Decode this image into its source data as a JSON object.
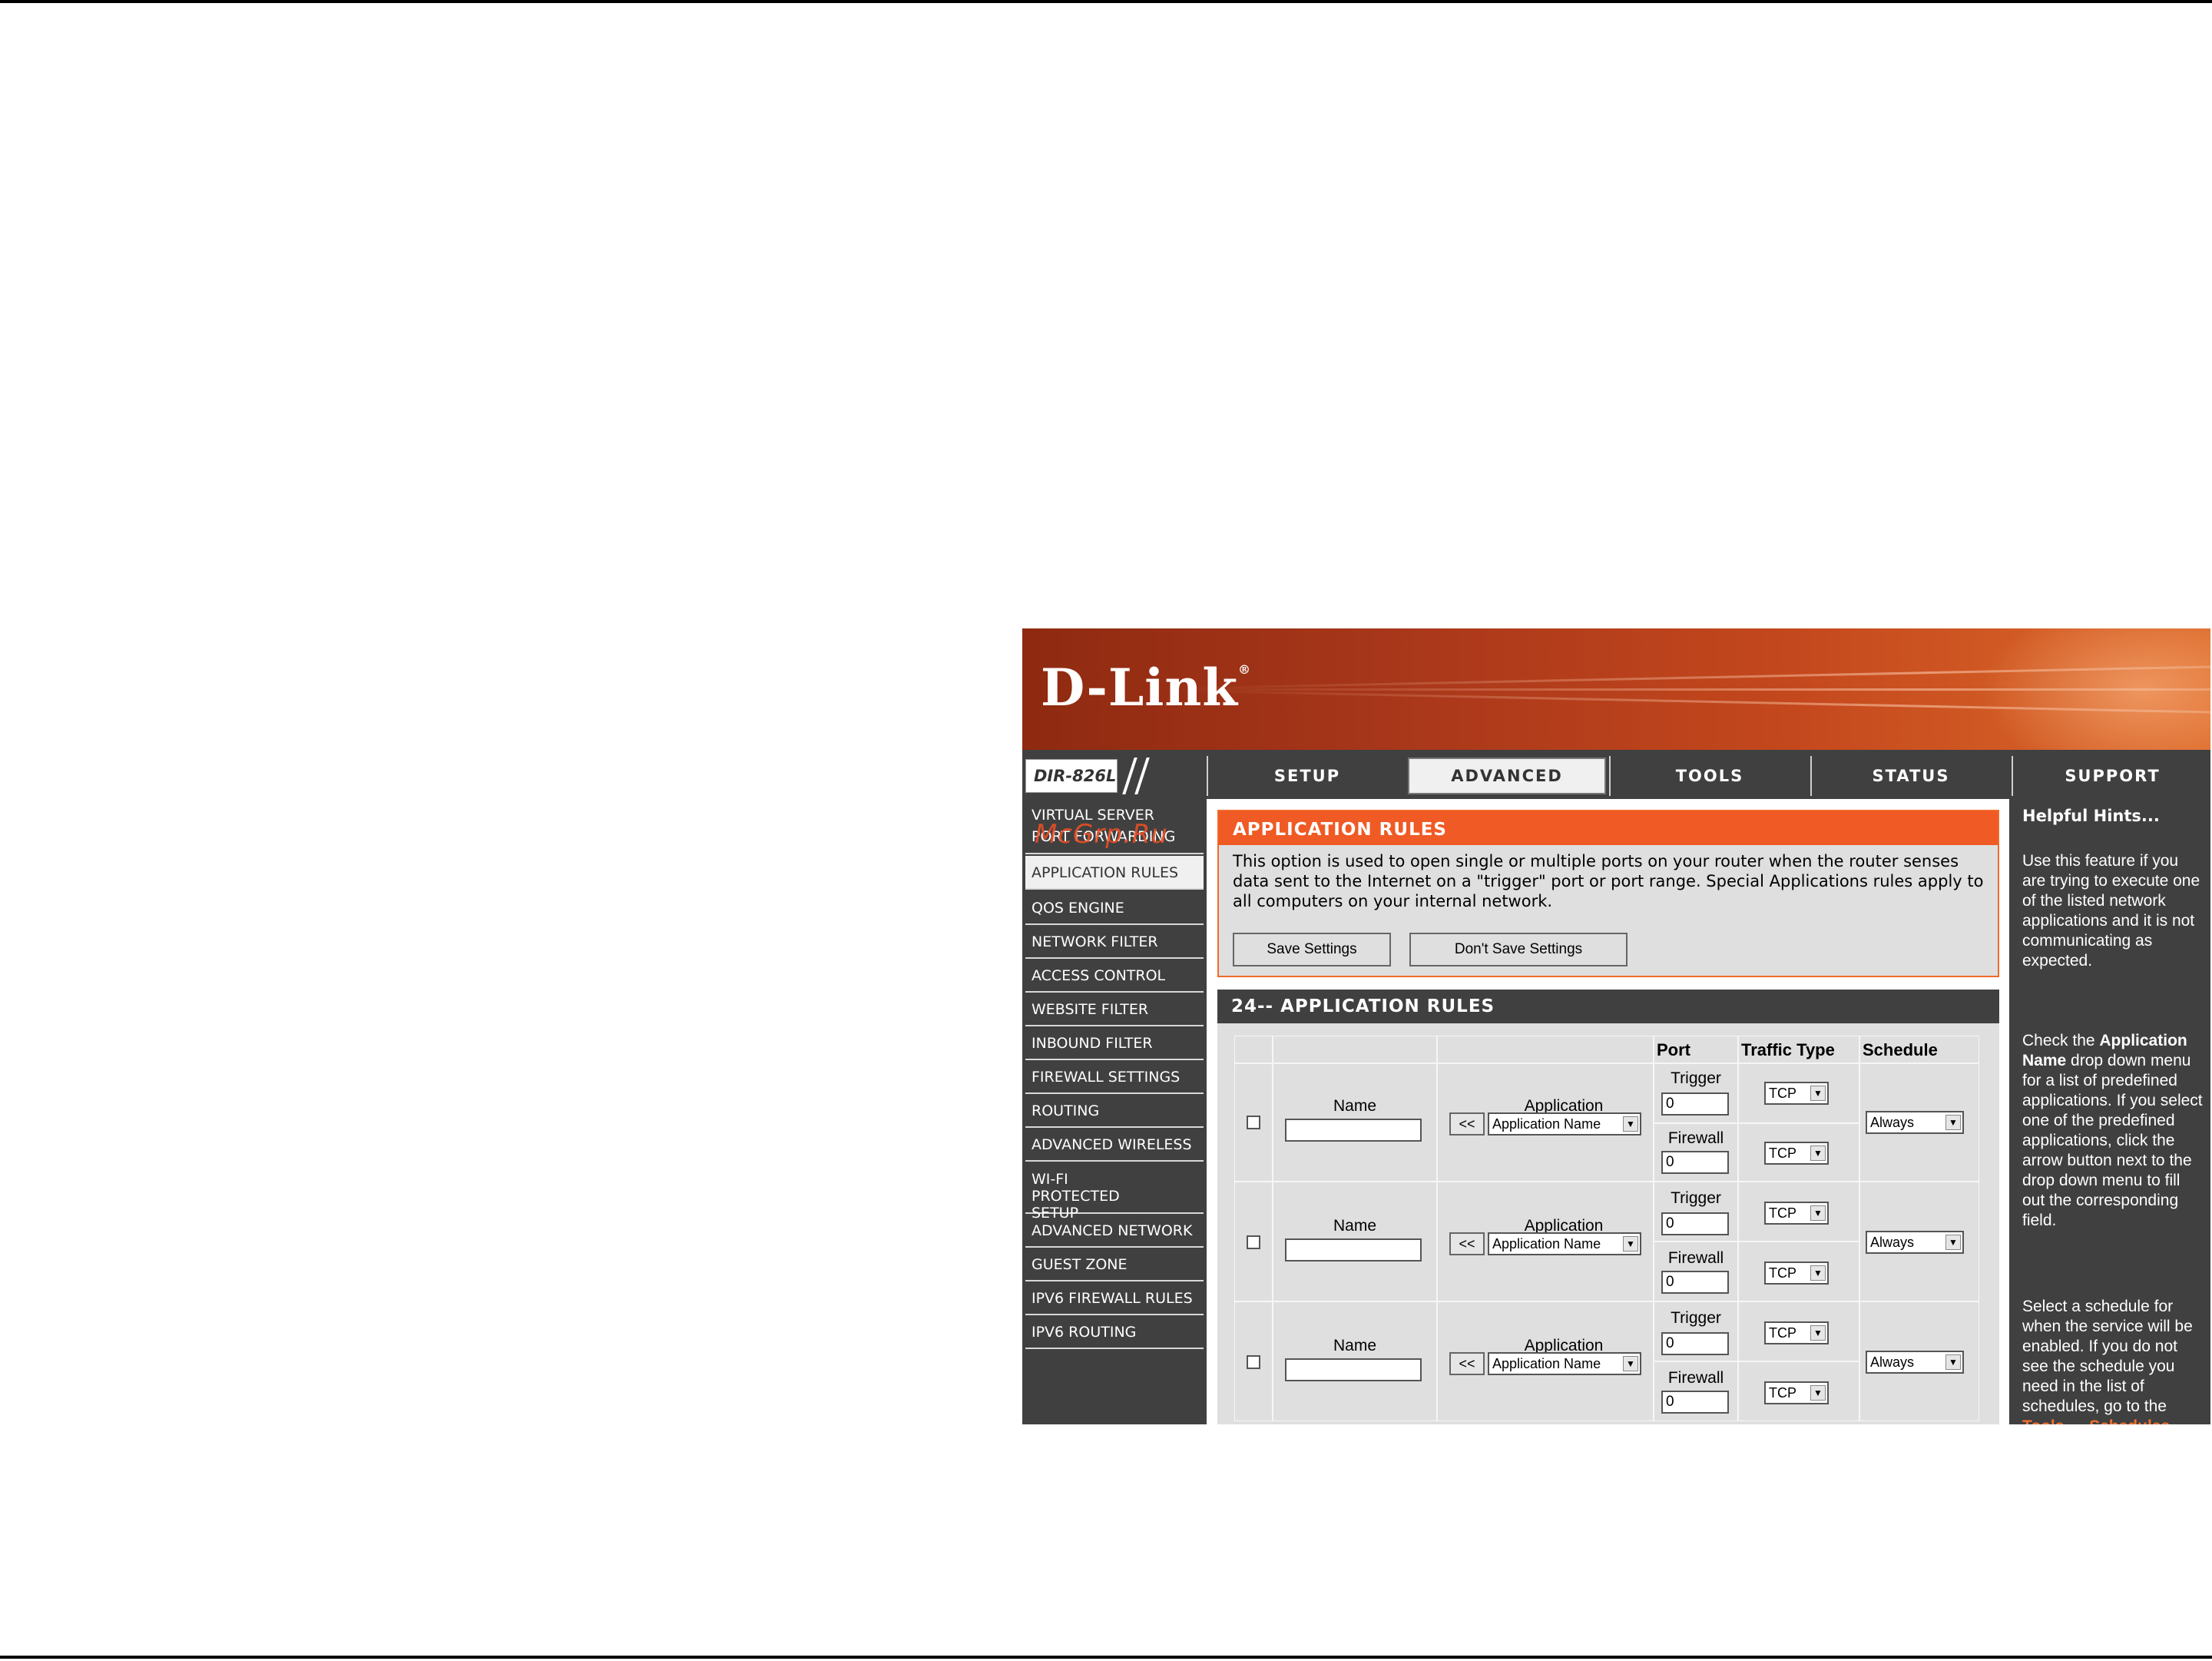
{
  "header": {
    "brand": "D-Link",
    "model": "DIR-826L"
  },
  "nav": {
    "tabs": [
      {
        "label": "SETUP"
      },
      {
        "label": "ADVANCED"
      },
      {
        "label": "TOOLS"
      },
      {
        "label": "STATUS"
      },
      {
        "label": "SUPPORT"
      }
    ]
  },
  "watermark": "McGrp.Ru",
  "sidebar": {
    "items": [
      {
        "label": "VIRTUAL SERVER"
      },
      {
        "label": "PORT FORWARDING"
      },
      {
        "label": "APPLICATION RULES"
      },
      {
        "label": "QOS ENGINE"
      },
      {
        "label": "NETWORK FILTER"
      },
      {
        "label": "ACCESS CONTROL"
      },
      {
        "label": "WEBSITE FILTER"
      },
      {
        "label": "INBOUND FILTER"
      },
      {
        "label": "FIREWALL SETTINGS"
      },
      {
        "label": "ROUTING"
      },
      {
        "label": "ADVANCED WIRELESS"
      },
      {
        "label": "WI-FI PROTECTED SETUP"
      },
      {
        "label": "ADVANCED NETWORK"
      },
      {
        "label": "GUEST ZONE"
      },
      {
        "label": "IPV6 FIREWALL RULES"
      },
      {
        "label": "IPV6 ROUTING"
      }
    ]
  },
  "intro": {
    "title": "APPLICATION RULES",
    "description": "This option is used to open single or multiple ports on your router when the router senses data sent to the Internet on a \"trigger\" port or port range. Special Applications rules apply to all computers on your internal network.",
    "save_label": "Save Settings",
    "dont_save_label": "Don't Save Settings"
  },
  "rules": {
    "title": "24-- APPLICATION RULES",
    "headers": {
      "port": "Port",
      "traffic_type": "Traffic Type",
      "schedule": "Schedule"
    },
    "labels": {
      "name": "Name",
      "application": "Application",
      "trigger": "Trigger",
      "firewall": "Firewall",
      "copy": "<<",
      "app_select": "Application Name",
      "tcp": "TCP",
      "always": "Always",
      "zero": "0"
    }
  },
  "hints": {
    "title": "Helpful Hints...",
    "p1": "Use this feature if you are trying to execute one of the listed network applications and it is not communicating as expected.",
    "p2_a": "Check the ",
    "p2_b": "Application Name",
    "p2_c": " drop down menu for a list of predefined applications. If you select one of the predefined applications, click the arrow button next to the drop down menu to fill out the corresponding field.",
    "p3": "Select a schedule for when the service will be enabled. If you do not see the schedule you need in the list of schedules, go to the",
    "p3_link": "Tools → Schedules"
  }
}
